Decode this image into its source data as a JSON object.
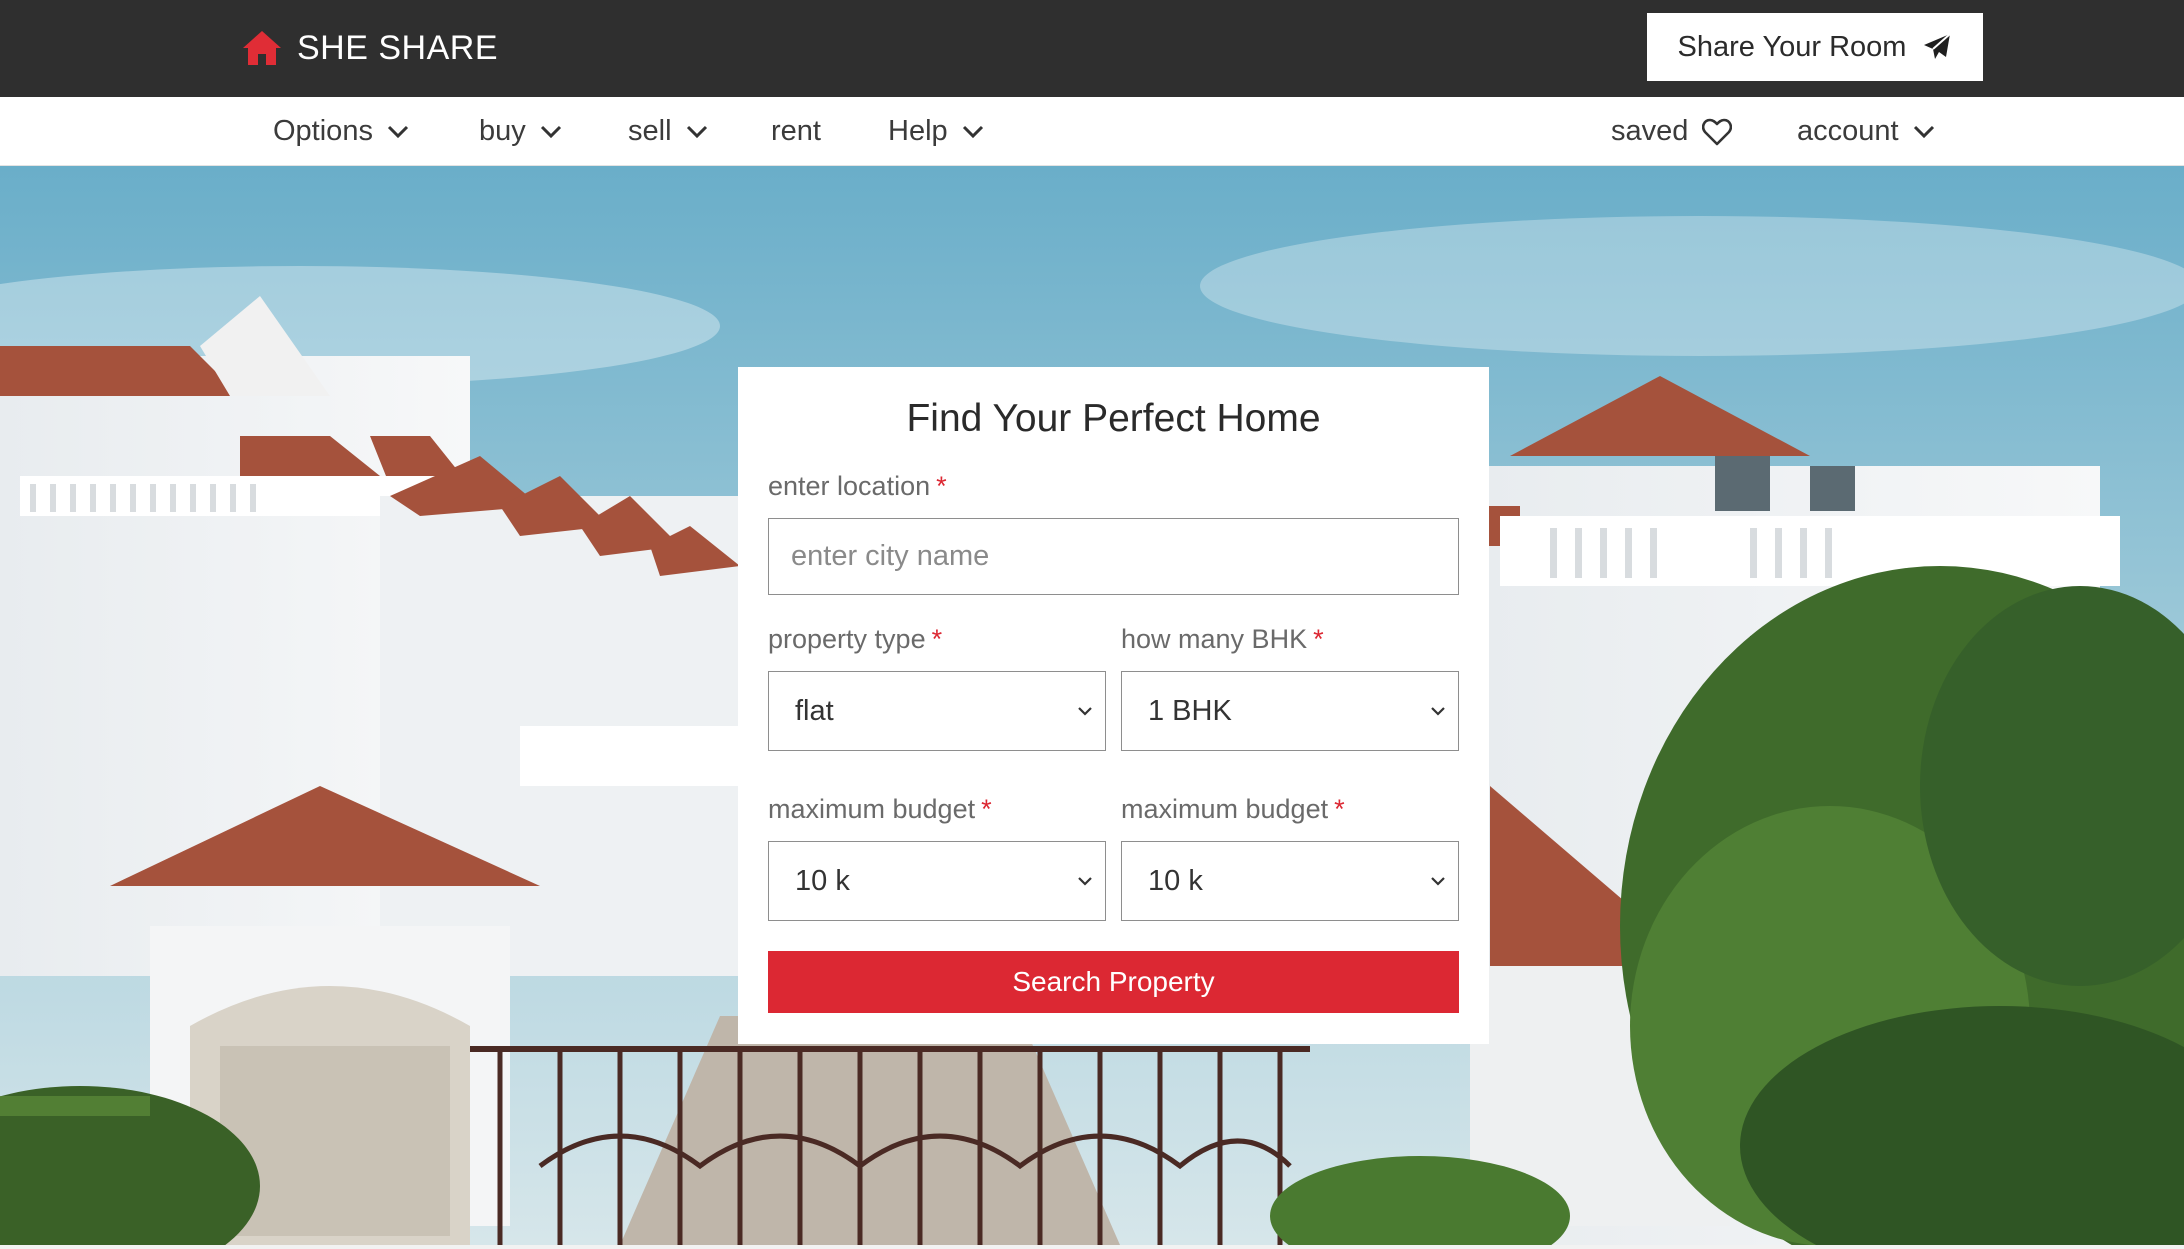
{
  "brand": {
    "name": "SHE SHARE",
    "icon": "home-icon",
    "icon_color": "#e02d36"
  },
  "header": {
    "share_button_label": "Share Your Room",
    "share_icon": "paper-plane-icon"
  },
  "nav": {
    "items": [
      {
        "label": "Options",
        "has_dropdown": true
      },
      {
        "label": "buy",
        "has_dropdown": true
      },
      {
        "label": "sell",
        "has_dropdown": true
      },
      {
        "label": "rent",
        "has_dropdown": false
      },
      {
        "label": "Help",
        "has_dropdown": true
      }
    ],
    "saved_label": "saved",
    "saved_icon": "heart-icon",
    "account_label": "account"
  },
  "search_card": {
    "title": "Find Your Perfect Home",
    "location": {
      "label": "enter location",
      "required_mark": "*",
      "placeholder": "enter city name"
    },
    "property_type": {
      "label": "property type",
      "required_mark": "*",
      "value": "flat"
    },
    "bhk": {
      "label": "how many BHK",
      "required_mark": "*",
      "value": "1 BHK"
    },
    "budget_min": {
      "label": "maximum budget",
      "required_mark": "*",
      "value": "10 k"
    },
    "budget_max": {
      "label": "maximum budget",
      "required_mark": "*",
      "value": "10 k"
    },
    "submit_label": "Search Property"
  },
  "colors": {
    "topbar": "#2f2f2f",
    "accent_red": "#dc2833",
    "sky": "#7bb6cf",
    "roof": "#a5523c"
  }
}
